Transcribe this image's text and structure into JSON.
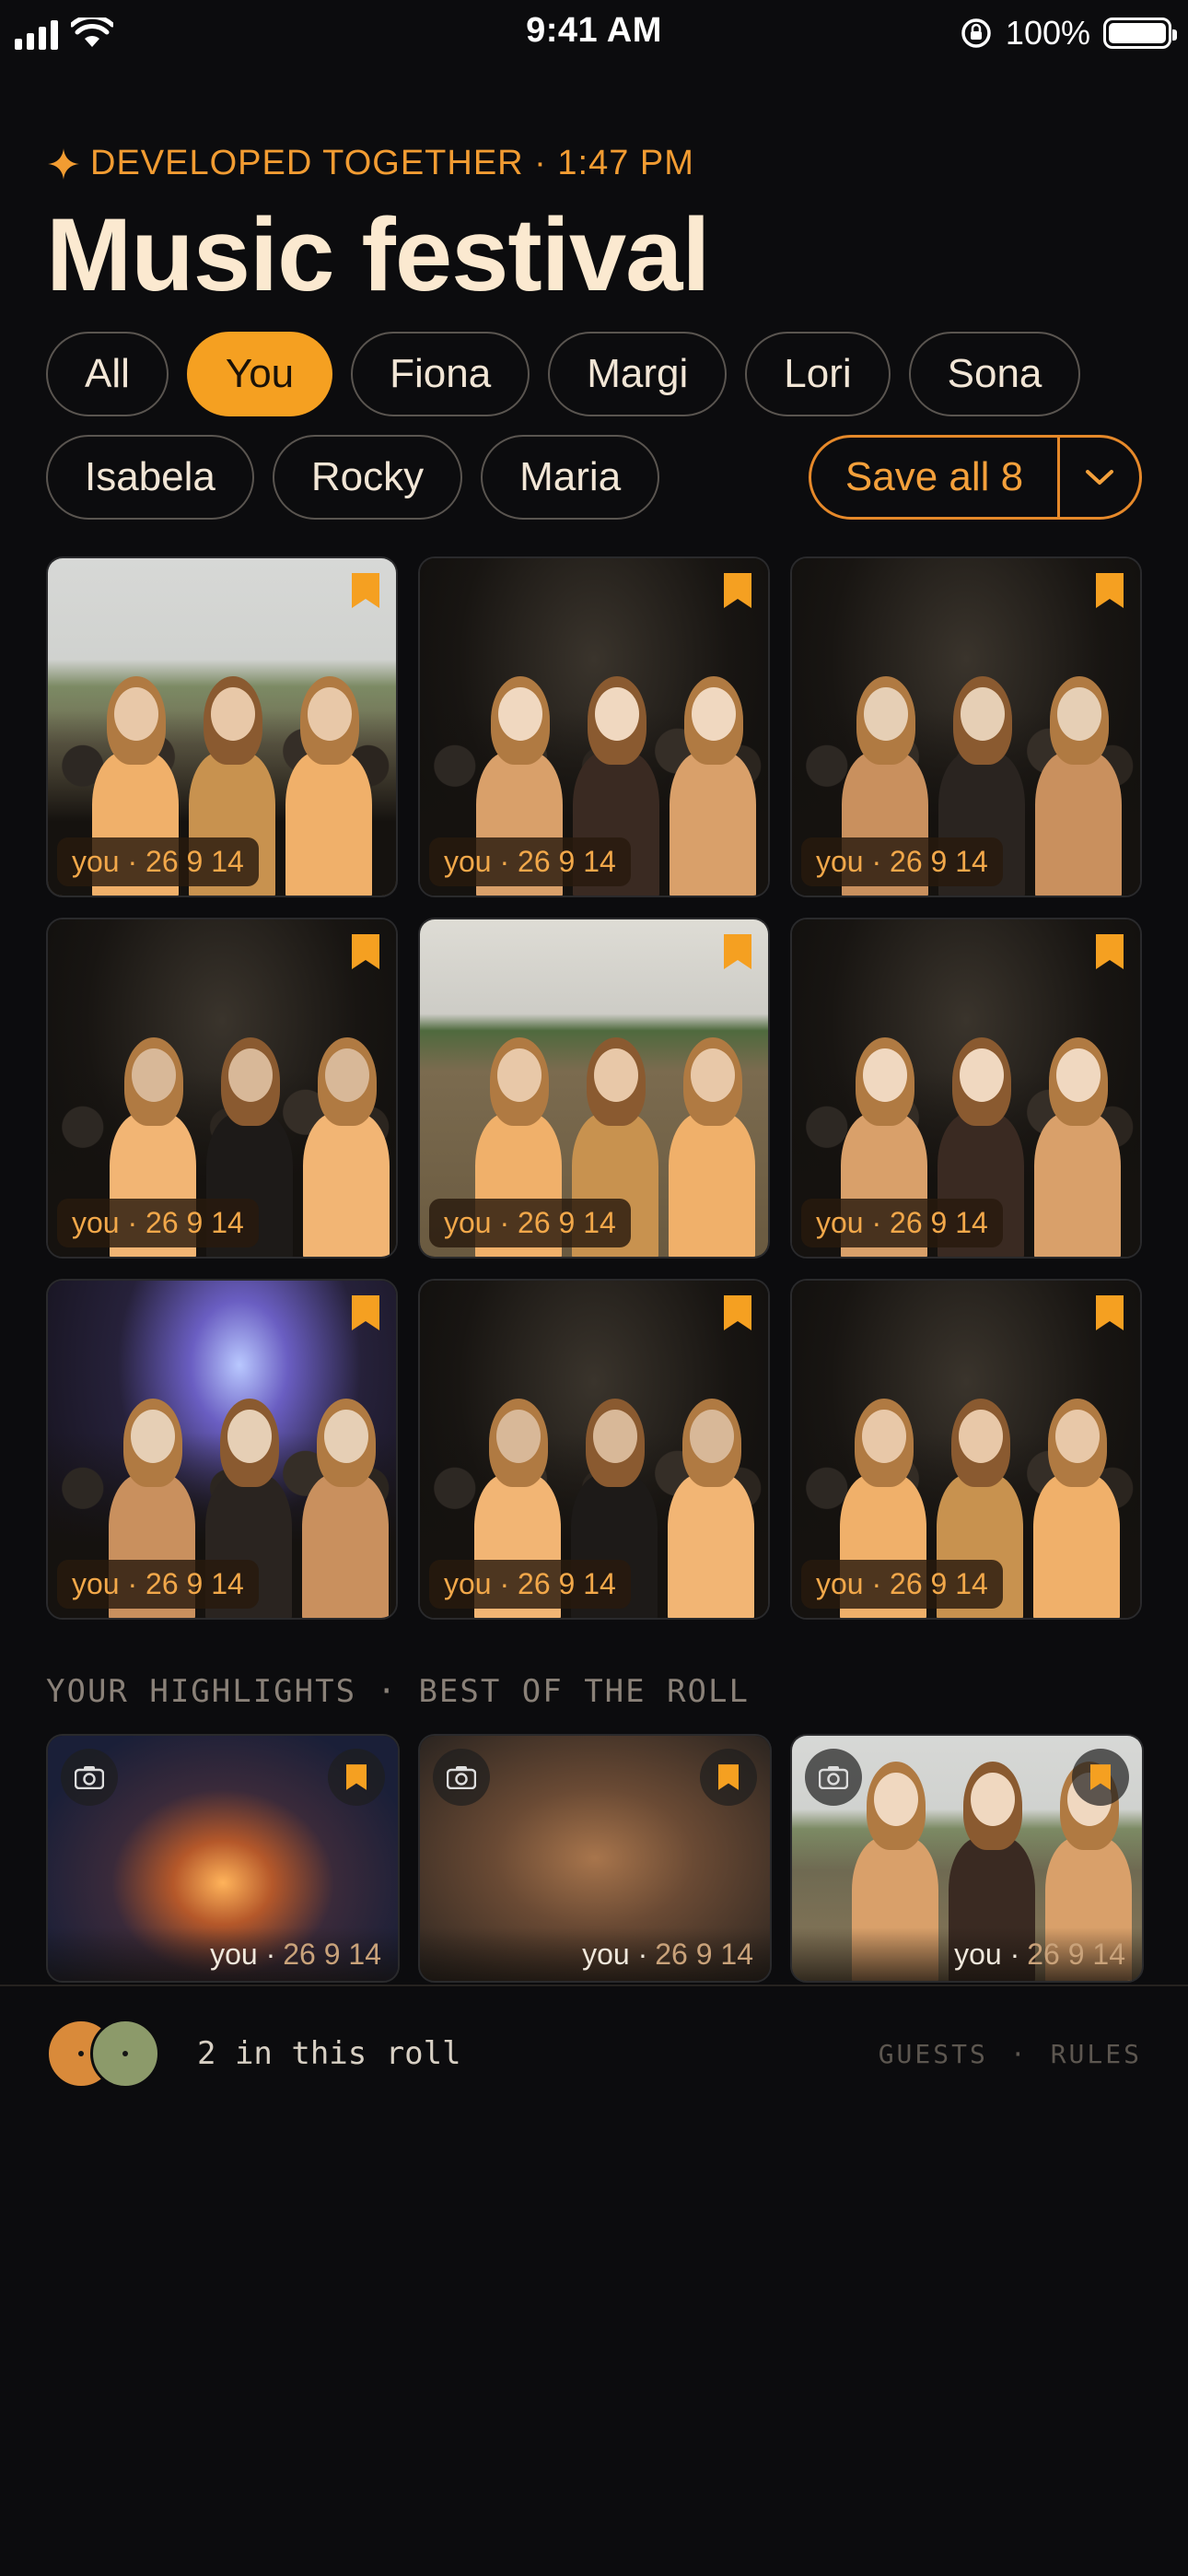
{
  "status_bar": {
    "time": "9:41 AM",
    "battery": "100%"
  },
  "header": {
    "eyebrow": "DEVELOPED TOGETHER · 1:47 PM",
    "title": "Music festival"
  },
  "filters": {
    "row1": [
      "All",
      "You",
      "Fiona",
      "Margi",
      "Lori",
      "Sona"
    ],
    "row2": [
      "Isabela",
      "Rocky",
      "Maria"
    ],
    "active": "You"
  },
  "save_all": {
    "label": "Save all 8"
  },
  "photos": [
    {
      "caption": "you · 26 9 14",
      "scene": "day"
    },
    {
      "caption": "you · 26 9 14",
      "scene": "night"
    },
    {
      "caption": "you · 26 9 14",
      "scene": "night"
    },
    {
      "caption": "you · 26 9 14",
      "scene": "night"
    },
    {
      "caption": "you · 26 9 14",
      "scene": "mud"
    },
    {
      "caption": "you · 26 9 14",
      "scene": "night"
    },
    {
      "caption": "you · 26 9 14",
      "scene": "stage"
    },
    {
      "caption": "you · 26 9 14",
      "scene": "night"
    },
    {
      "caption": "you · 26 9 14",
      "scene": "night"
    }
  ],
  "highlights": {
    "label": "YOUR HIGHLIGHTS · BEST OF THE ROLL",
    "items": [
      {
        "who": "you ·",
        "date": "26 9 14",
        "scene": "concert"
      },
      {
        "who": "you ·",
        "date": "26 9 14",
        "scene": "jewel"
      },
      {
        "who": "you ·",
        "date": "26 9 14",
        "scene": "day"
      }
    ]
  },
  "footer": {
    "roll_count": "2 in this roll",
    "links": [
      "GUESTS",
      "·",
      "RULES"
    ]
  },
  "colors": {
    "accent": "#f5a021",
    "background": "#0c0c0e",
    "avatar_1": "#d98a3a",
    "avatar_2": "#8c9a6a"
  }
}
